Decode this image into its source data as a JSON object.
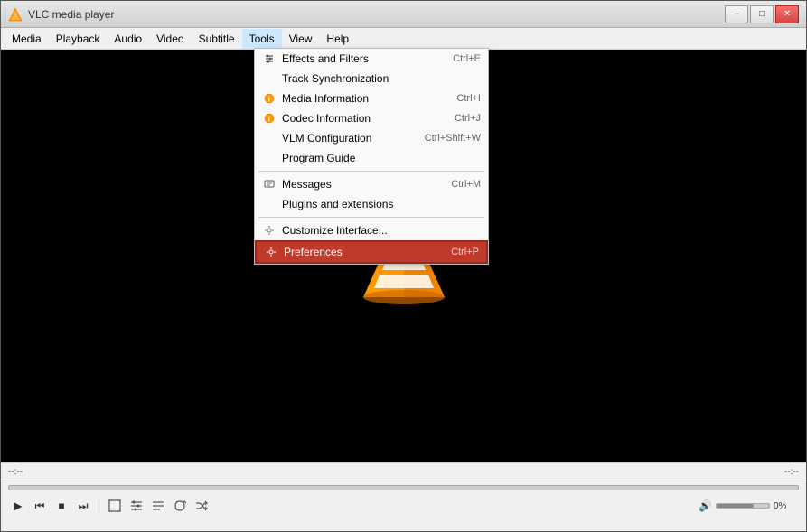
{
  "window": {
    "title": "VLC media player",
    "min_label": "–",
    "max_label": "□",
    "close_label": "✕"
  },
  "menubar": {
    "items": [
      {
        "id": "media",
        "label": "Media"
      },
      {
        "id": "playback",
        "label": "Playback"
      },
      {
        "id": "audio",
        "label": "Audio"
      },
      {
        "id": "video",
        "label": "Video"
      },
      {
        "id": "subtitle",
        "label": "Subtitle"
      },
      {
        "id": "tools",
        "label": "Tools"
      },
      {
        "id": "view",
        "label": "View"
      },
      {
        "id": "help",
        "label": "Help"
      }
    ]
  },
  "tools_menu": {
    "items": [
      {
        "id": "effects-filters",
        "label": "Effects and Filters",
        "shortcut": "Ctrl+E",
        "icon": "sliders"
      },
      {
        "id": "track-sync",
        "label": "Track Synchronization",
        "shortcut": "",
        "icon": ""
      },
      {
        "id": "media-info",
        "label": "Media Information",
        "shortcut": "Ctrl+I",
        "icon": "info-orange"
      },
      {
        "id": "codec-info",
        "label": "Codec Information",
        "shortcut": "Ctrl+J",
        "icon": "info-orange"
      },
      {
        "id": "vlm-config",
        "label": "VLM Configuration",
        "shortcut": "Ctrl+Shift+W",
        "icon": ""
      },
      {
        "id": "program-guide",
        "label": "Program Guide",
        "shortcut": "",
        "icon": ""
      },
      {
        "separator": true
      },
      {
        "id": "messages",
        "label": "Messages",
        "shortcut": "Ctrl+M",
        "icon": "doc"
      },
      {
        "id": "plugins",
        "label": "Plugins and extensions",
        "shortcut": "",
        "icon": ""
      },
      {
        "separator2": true
      },
      {
        "id": "customize",
        "label": "Customize Interface...",
        "shortcut": "",
        "icon": "wrench"
      },
      {
        "id": "preferences",
        "label": "Preferences",
        "shortcut": "Ctrl+P",
        "icon": "wrench",
        "highlighted": true
      }
    ]
  },
  "status": {
    "left": "--:--",
    "right": "--:--"
  },
  "controls": {
    "play_label": "▶",
    "prev_label": "⏮",
    "stop_label": "■",
    "next_label": "⏭",
    "fullscreen_label": "⛶",
    "extended_label": "≡",
    "playlist_label": "☰",
    "loop_label": "↺",
    "random_label": "⤮",
    "volume_icon": "🔊",
    "volume_pct": "0%"
  }
}
